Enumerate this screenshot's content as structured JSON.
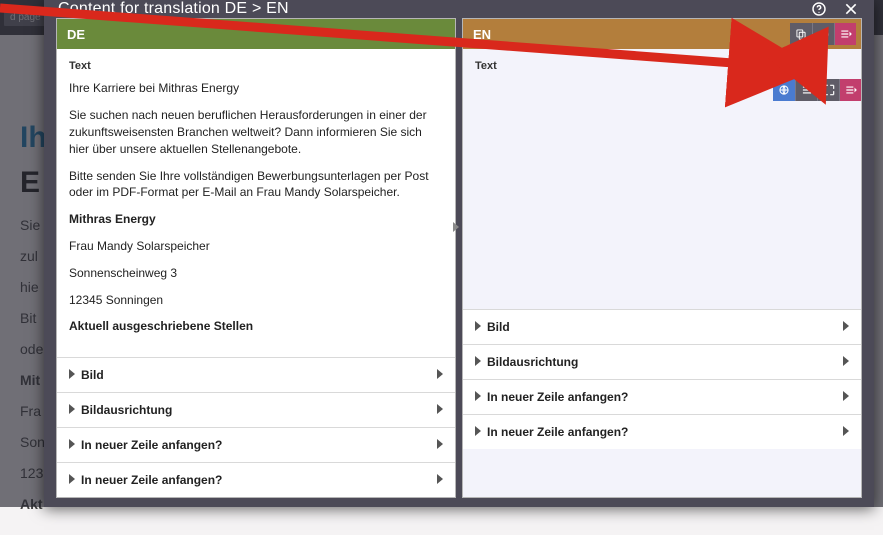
{
  "bg": {
    "topbar_btn": "d page",
    "h1_blue": "Ih",
    "h1_black": "E",
    "p1": "Sie",
    "p2": "zul",
    "p3": "hie",
    "p4": "Bit",
    "p5": "ode",
    "mit": "Mit",
    "fra": "Fra",
    "son": "Son",
    "plz": "123",
    "akt": "Akt"
  },
  "modal": {
    "title": "Content for translation DE > EN"
  },
  "de": {
    "lang": "DE",
    "text_label": "Text",
    "p1": "Ihre Karriere bei Mithras Energy",
    "p2": "Sie suchen nach neuen beruflichen Herausforderungen in einer der zukunftsweisensten Branchen weltweit? Dann informieren Sie sich hier über unsere aktuellen Stellenangebote.",
    "p3": "Bitte senden Sie Ihre vollständigen Bewerbungsunterlagen per Post oder im PDF-Format per E-Mail an Frau Mandy Solarspeicher.",
    "company": "Mithras Energy",
    "contact": "Frau Mandy Solarspeicher",
    "street": "Sonnenscheinweg 3",
    "city": "12345 Sonningen",
    "heading": "Aktuell ausgeschriebene Stellen",
    "fields": {
      "bild": "Bild",
      "bildausrichtung": "Bildausrichtung",
      "newline1": "In neuer Zeile anfangen?",
      "newline2": "In neuer Zeile anfangen?"
    }
  },
  "en": {
    "lang": "EN",
    "text_label": "Text",
    "fields": {
      "bild": "Bild",
      "bildausrichtung": "Bildausrichtung",
      "newline1": "In neuer Zeile anfangen?",
      "newline2": "In neuer Zeile anfangen?"
    }
  }
}
